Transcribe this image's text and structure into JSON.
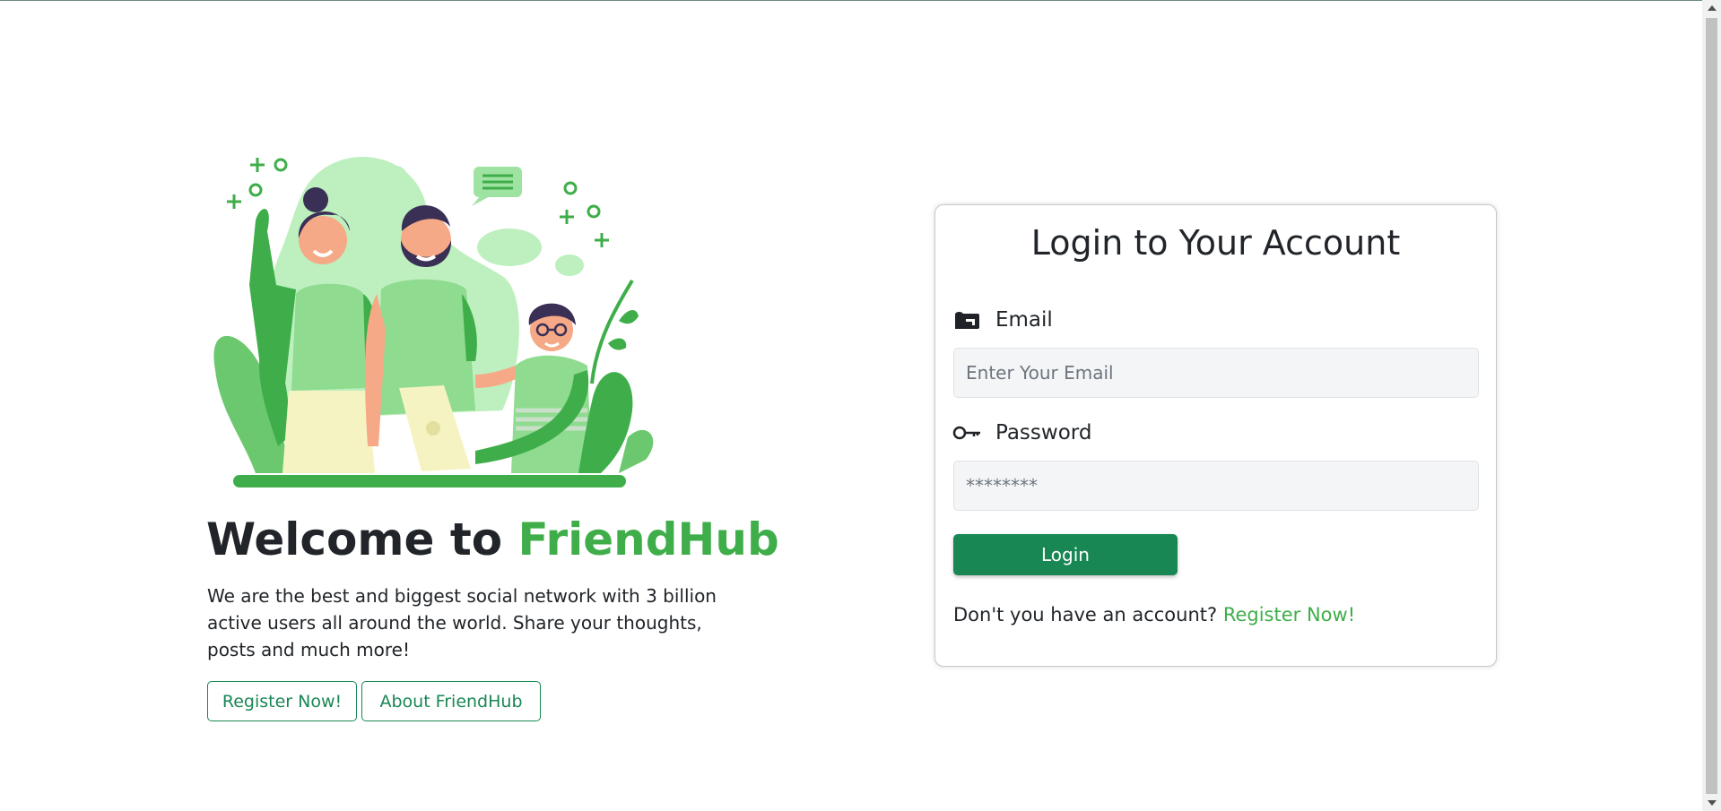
{
  "hero": {
    "title_prefix": "Welcome to ",
    "title_brand": "FriendHub",
    "description": "We are the best and biggest social network with 3 billion active users all around the world. Share your thoughts, posts and much more!",
    "register_button": "Register Now!",
    "about_button": "About FriendHub"
  },
  "login": {
    "title": "Login to Your Account",
    "email_label": "Email",
    "email_placeholder": "Enter Your Email",
    "password_label": "Password",
    "password_placeholder": "********",
    "login_button": "Login",
    "signup_prompt": "Don't you have an account?",
    "signup_link": "Register Now!"
  },
  "colors": {
    "brand_green": "#3fae4a",
    "button_green": "#198754",
    "input_bg": "#f4f5f7"
  },
  "icons": {
    "email": "mailbox-icon",
    "password": "key-icon"
  }
}
